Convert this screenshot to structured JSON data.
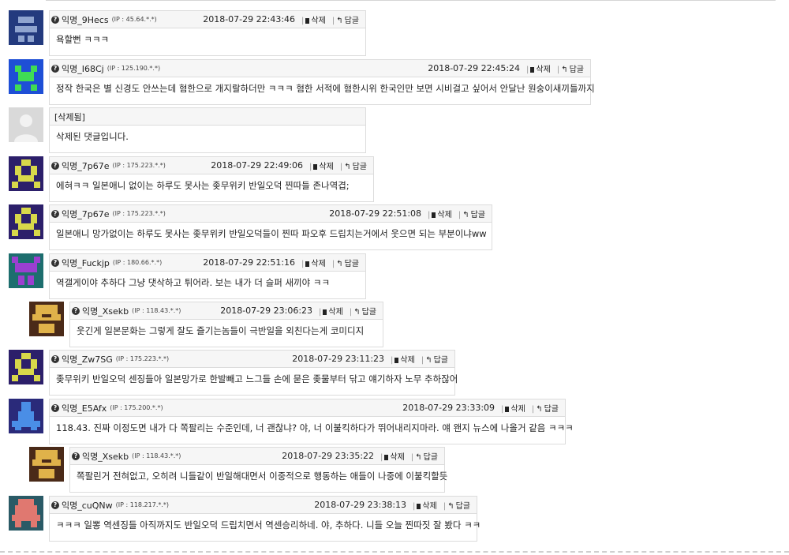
{
  "action_labels": {
    "delete": "삭제",
    "reply": "답글"
  },
  "comments": [
    {
      "name": "익명_9Hecs",
      "ip": "(IP : 45.64.*.*)",
      "date": "2018-07-29 22:43:46",
      "text": "욕할뻔 ㅋㅋㅋ",
      "avatar_color": "#233a7e"
    },
    {
      "name": "익명_I68Cj",
      "ip": "(IP : 125.190.*.*)",
      "date": "2018-07-29 22:45:24",
      "text": "정작 한국은 별 신경도 안쓰는데 혐한으로 개지랄하더만 ㅋㅋㅋ 혐한 서적에 혐한시위 한국인만 보면 시비걸고 싶어서 안달난 원숭이새끼들까지",
      "avatar_color": "#1e4fd6"
    },
    {
      "deleted_label": "[삭제됨]",
      "text": "삭제된 댓글입니다.",
      "avatar_color": "#d9d9d9"
    },
    {
      "name": "익명_7p67e",
      "ip": "(IP : 175.223.*.*)",
      "date": "2018-07-29 22:49:06",
      "text": "에혀ㅋㅋ 일본애니 없이는 하루도 못사는 좆무위키 반일오덕 찐따들 존나역겹;",
      "avatar_color": "#2c1f6a"
    },
    {
      "name": "익명_7p67e",
      "ip": "(IP : 175.223.*.*)",
      "date": "2018-07-29 22:51:08",
      "text": "일본애니 망가없이는 하루도 못사는 좆무위키 반일오덕들이 찐따 파오후 드립치는거에서 웃으면 되는 부분이냐ww",
      "avatar_color": "#2c1f6a"
    },
    {
      "name": "익명_Fuckjp",
      "ip": "(IP : 180.66.*.*)",
      "date": "2018-07-29 22:51:16",
      "text": "역갤게이야 추하다 그냥 댓삭하고 튀어라. 보는 내가 더 슬퍼 새끼야 ㅋㅋ",
      "avatar_color": "#1d6e6e"
    },
    {
      "name": "익명_Xsekb",
      "ip": "(IP : 118.43.*.*)",
      "date": "2018-07-29 23:06:23",
      "text": "웃긴게 일본문화는 그렇게 잘도 즐기는놈들이 극반일을 외친다는게 코미디지",
      "avatar_color": "#4a2a18"
    },
    {
      "name": "익명_Zw7SG",
      "ip": "(IP : 175.223.*.*)",
      "date": "2018-07-29 23:11:23",
      "text": "좆무위키 반일오덕 센징들아 일본망가로 한발빼고 느그들 손에 묻은 좆물부터 닦고 얘기하자 노무 추하잖어",
      "avatar_color": "#2c1f6a"
    },
    {
      "name": "익명_E5Afx",
      "ip": "(IP : 175.200.*.*)",
      "date": "2018-07-29 23:33:09",
      "text": "118.43. 진짜 이정도면 내가 다 쪽팔리는 수준인데, 너 괜찮냐? 야, 너 이불킥하다가 뛰어내리지마라. 얘 왠지 뉴스에 나올거 같음 ㅋㅋㅋ",
      "avatar_color": "#2a2a7a"
    },
    {
      "name": "익명_Xsekb",
      "ip": "(IP : 118.43.*.*)",
      "date": "2018-07-29 23:35:22",
      "text": "쪽팔린거 전혀없고, 오히려 니들같이 반일해대면서 이중적으로 행동하는 애들이 나중에 이불킥할듯",
      "avatar_color": "#4a2a18"
    },
    {
      "name": "익명_cuQNw",
      "ip": "(IP : 118.217.*.*)",
      "date": "2018-07-29 23:38:13",
      "text": "ㅋㅋㅋ 일뽕 역센징들 아직까지도 반일오덕 드립치면서 역센승리하네. 야, 추하다. 니들 오늘 찐따짓 잘 봤다 ㅋㅋ",
      "avatar_color": "#2a5a66"
    }
  ]
}
